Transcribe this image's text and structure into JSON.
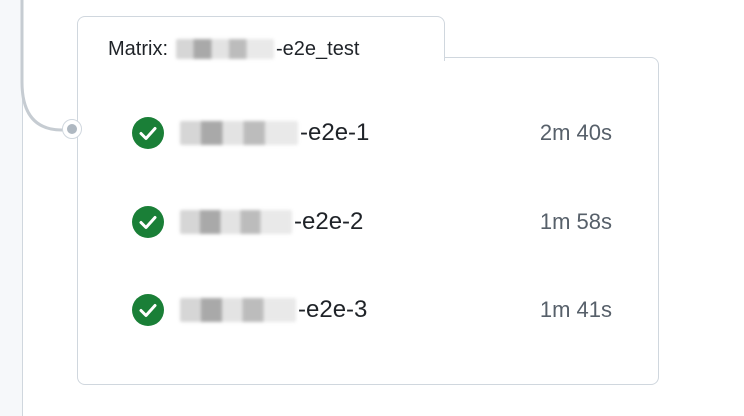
{
  "matrix": {
    "prefix": "Matrix:",
    "name_suffix": "-e2e_test"
  },
  "jobs": [
    {
      "name_suffix": "-e2e-1",
      "duration": "2m 40s",
      "status": "success"
    },
    {
      "name_suffix": "-e2e-2",
      "duration": "1m 58s",
      "status": "success"
    },
    {
      "name_suffix": "-e2e-3",
      "duration": "1m 41s",
      "status": "success"
    }
  ],
  "colors": {
    "success": "#1a7f37",
    "border": "#d0d7de",
    "muted": "#57606a"
  }
}
